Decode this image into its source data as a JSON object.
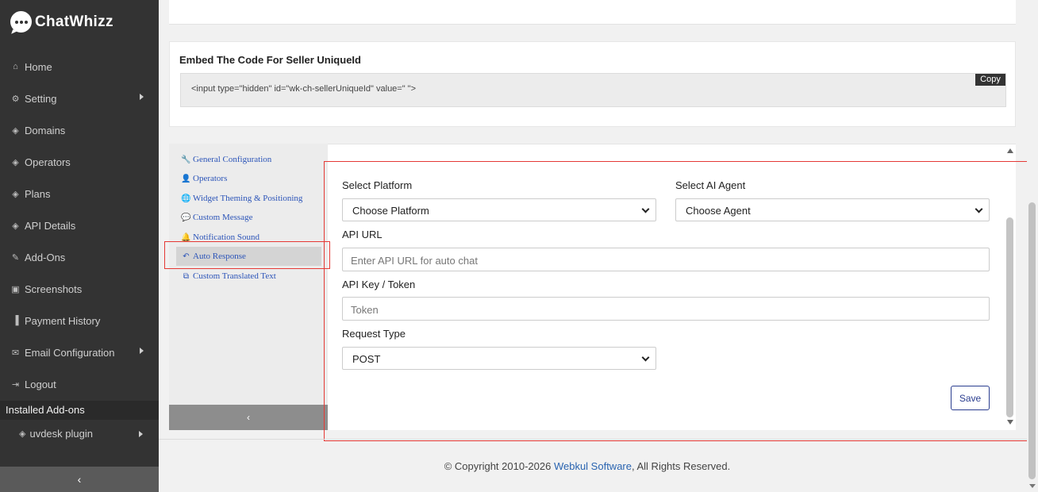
{
  "brand": {
    "name": "ChatWhizz"
  },
  "sidebar": {
    "items": [
      {
        "label": "Home",
        "icon": "home-icon",
        "glyph": "⌂",
        "has_submenu": false
      },
      {
        "label": "Setting",
        "icon": "cogs-icon",
        "glyph": "⚙",
        "has_submenu": true
      },
      {
        "label": "Domains",
        "icon": "cube-icon",
        "glyph": "◈",
        "has_submenu": false
      },
      {
        "label": "Operators",
        "icon": "cube-icon",
        "glyph": "◈",
        "has_submenu": false
      },
      {
        "label": "Plans",
        "icon": "cube-icon",
        "glyph": "◈",
        "has_submenu": false
      },
      {
        "label": "API Details",
        "icon": "cube-icon",
        "glyph": "◈",
        "has_submenu": false
      },
      {
        "label": "Add-Ons",
        "icon": "plug-icon",
        "glyph": "✎",
        "has_submenu": false
      },
      {
        "label": "Screenshots",
        "icon": "image-icon",
        "glyph": "▣",
        "has_submenu": false
      },
      {
        "label": "Payment History",
        "icon": "bookmark-icon",
        "glyph": "▐",
        "has_submenu": false
      },
      {
        "label": "Email Configuration",
        "icon": "envelope-icon",
        "glyph": "✉",
        "has_submenu": true
      },
      {
        "label": "Logout",
        "icon": "signout-icon",
        "glyph": "⇥",
        "has_submenu": false
      }
    ],
    "installed_heading": "Installed Add-ons",
    "installed_items": [
      {
        "label": "uvdesk plugin",
        "icon": "cube-icon",
        "glyph": "◈",
        "has_submenu": true
      }
    ],
    "collapse_glyph": "‹"
  },
  "embed": {
    "title": "Embed The Code For Seller UniqueId",
    "code": "<input type=\"hidden\" id=\"wk-ch-sellerUniqueId\" value=\" \">",
    "copy_label": "Copy"
  },
  "settings_tabs": [
    {
      "label": "General Configuration",
      "icon": "wrench-icon",
      "glyph": "🔧",
      "active": false
    },
    {
      "label": "Operators",
      "icon": "user-icon",
      "glyph": "👤",
      "active": false
    },
    {
      "label": "Widget Theming & Positioning",
      "icon": "globe-icon",
      "glyph": "🌐",
      "active": false
    },
    {
      "label": "Custom Message",
      "icon": "comment-icon",
      "glyph": "💬",
      "active": false
    },
    {
      "label": "Notification Sound",
      "icon": "bell-icon",
      "glyph": "🔔",
      "active": false
    },
    {
      "label": "Auto Response",
      "icon": "reply-icon",
      "glyph": "↶",
      "active": true
    },
    {
      "label": "Custom Translated Text",
      "icon": "translate-icon",
      "glyph": "⧉",
      "active": false
    }
  ],
  "settings_collapse_glyph": "‹",
  "form": {
    "platform_label": "Select Platform",
    "platform_value": "Choose Platform",
    "agent_label": "Select AI Agent",
    "agent_value": "Choose Agent",
    "api_url_label": "API URL",
    "api_url_placeholder": "Enter API URL for auto chat",
    "token_label": "API Key / Token",
    "token_placeholder": "Token",
    "request_type_label": "Request Type",
    "request_type_value": "POST",
    "save_label": "Save"
  },
  "footer": {
    "prefix": "© Copyright 2010-2026 ",
    "link": "Webkul Software",
    "suffix": ", All Rights Reserved."
  },
  "colors": {
    "highlight": "#e53935",
    "link": "#2b54b8",
    "sidebar_bg": "#333333"
  }
}
